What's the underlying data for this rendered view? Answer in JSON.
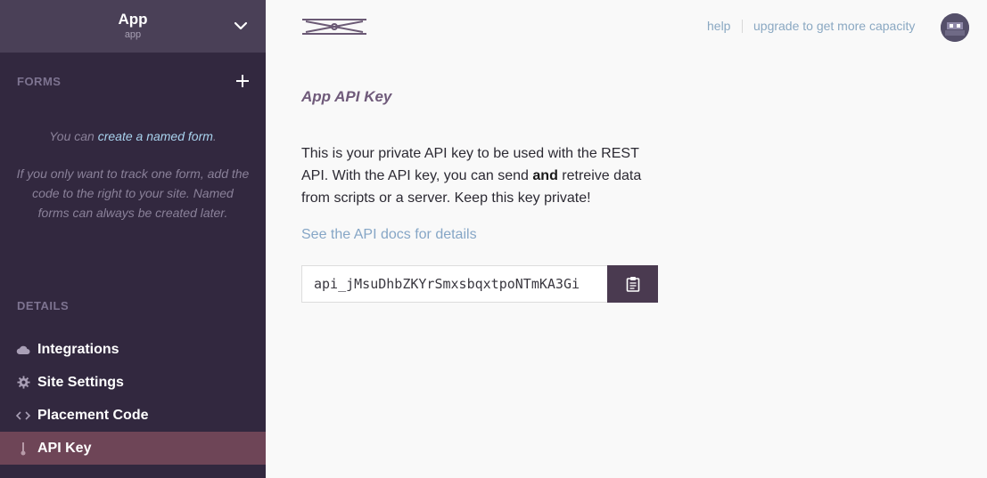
{
  "app": {
    "name": "App",
    "subtitle": "app"
  },
  "sidebar": {
    "forms_label": "FORMS",
    "empty_prefix": "You can ",
    "empty_link": "create a named form",
    "empty_suffix": ".",
    "empty_note": "If you only want to track one form, add the code to the right to your site. Named forms can always be created later.",
    "details_label": "DETAILS",
    "items": [
      {
        "label": "Integrations",
        "icon": "cloud-icon"
      },
      {
        "label": "Site Settings",
        "icon": "gear-icon"
      },
      {
        "label": "Placement Code",
        "icon": "code-icon"
      },
      {
        "label": "API Key",
        "icon": "key-icon"
      }
    ]
  },
  "topbar": {
    "help": "help",
    "upgrade": "upgrade to get more capacity"
  },
  "main": {
    "title": "App API Key",
    "desc_part1": "This is your private API key to be used with the REST API. With the API key, you can send ",
    "desc_bold": "and",
    "desc_part2": " retreive data from scripts or a server. Keep this key private!",
    "docs_link": "See the API docs for details",
    "api_key": "api_jMsuDhbZKYrSmxsbqxtpoNTmKA3Gi"
  },
  "colors": {
    "sidebar_bg": "#32283f",
    "header_bg": "#4a4057",
    "active_bg": "#6e4557",
    "link": "#86a6c6",
    "button_bg": "#4a3a50"
  }
}
